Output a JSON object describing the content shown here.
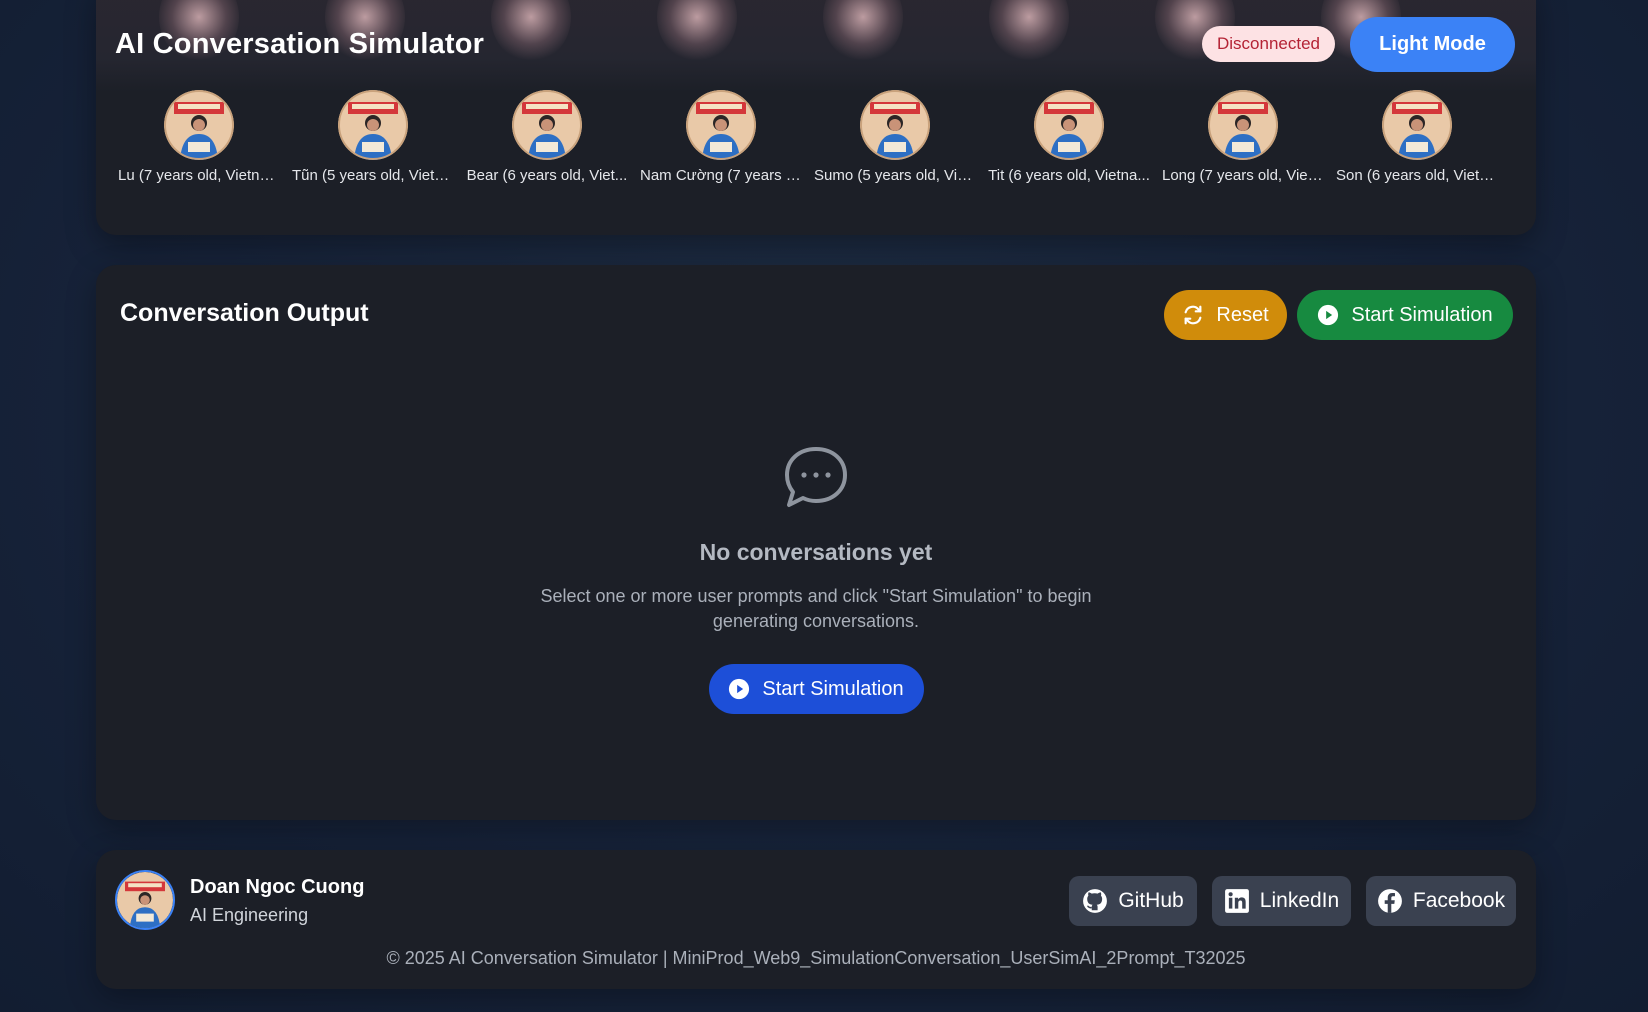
{
  "header": {
    "title": "AI Conversation Simulator",
    "status": "Disconnected",
    "theme_toggle_label": "Light Mode"
  },
  "personas": [
    {
      "name": "Lu (7 years old, Vietna..."
    },
    {
      "name": "Tũn (5 years old, Vietn..."
    },
    {
      "name": "Bear (6 years old, Viet..."
    },
    {
      "name": "Nam Cường (7 years o..."
    },
    {
      "name": "Sumo (5 years old, Vie..."
    },
    {
      "name": "Tit (6 years old, Vietna..."
    },
    {
      "name": "Long (7 years old, Viet..."
    },
    {
      "name": "Son (6 years old, Vietn..."
    }
  ],
  "output": {
    "title": "Conversation Output",
    "reset_label": "Reset",
    "start_label": "Start Simulation",
    "empty_title": "No conversations yet",
    "empty_description": "Select one or more user prompts and click \"Start Simulation\" to begin generating conversations.",
    "empty_start_label": "Start Simulation"
  },
  "footer": {
    "author_name": "Doan Ngoc Cuong",
    "author_role": "AI Engineering",
    "github_label": "GitHub",
    "linkedin_label": "LinkedIn",
    "facebook_label": "Facebook",
    "copyright": "© 2025 AI Conversation Simulator | MiniProd_Web9_SimulationConversation_UserSimAI_2Prompt_T32025"
  },
  "icons": {
    "reset": "refresh-icon",
    "start": "play-circle-icon",
    "empty": "chat-bubble-icon",
    "github": "github-icon",
    "linkedin": "linkedin-icon",
    "facebook": "facebook-icon"
  },
  "colors": {
    "theme_button": "#3b82f6",
    "reset_button": "#d08c0b",
    "start_button_top": "#178a40",
    "start_button_center": "#1d4fd8",
    "status_badge_bg": "#fde2e4",
    "status_badge_text": "#b42335"
  }
}
